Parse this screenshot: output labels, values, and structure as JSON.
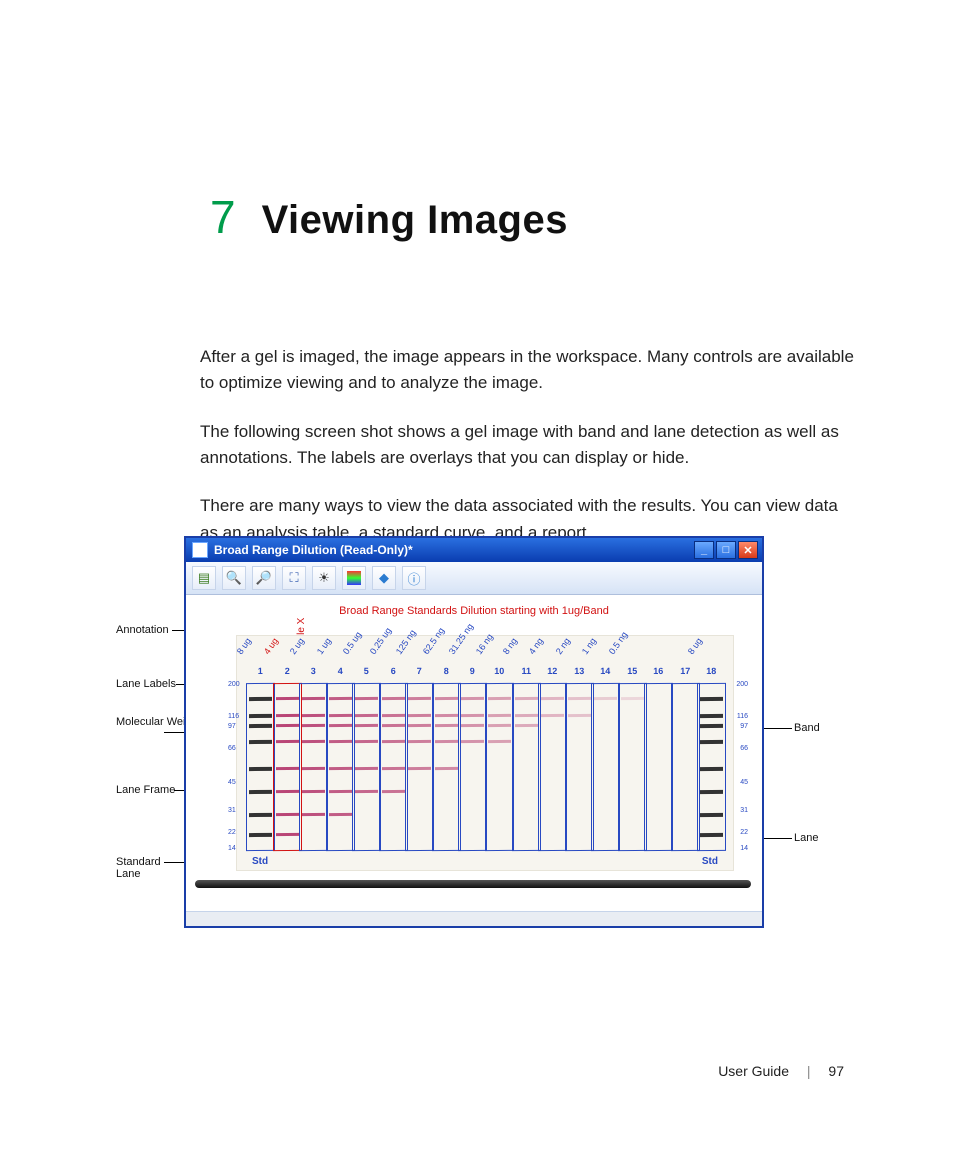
{
  "chapter": {
    "number": "7",
    "title": "Viewing Images"
  },
  "paragraphs": {
    "p1": "After a gel is imaged, the image appears in the workspace. Many controls are available to optimize viewing and to analyze the image.",
    "p2": "The following screen shot shows a gel image with band and lane detection as well as annotations. The labels are overlays that you can display or hide.",
    "p3": "There are many ways to view the data associated with the results. You can view data as an analysis table, a standard curve, and a report."
  },
  "window": {
    "title": "Broad Range Dilution (Read-Only)*",
    "heading": "Broad Range Standards Dilution starting with 1ug/Band",
    "sample_annotation": "Sample X",
    "std_label": "Std",
    "lane_top_labels": [
      "8 ug",
      "4 ug",
      "2 ug",
      "1 ug",
      "0.5 ug",
      "0.25 ug",
      "125 ng",
      "62.5 ng",
      "31.25 ng",
      "16 ng",
      "8 ng",
      "4 ng",
      "2 ng",
      "1 ng",
      "0.5 ng",
      "",
      "",
      "8 ug"
    ],
    "lane_numbers": [
      "1",
      "2",
      "3",
      "4",
      "5",
      "6",
      "7",
      "8",
      "9",
      "10",
      "11",
      "12",
      "13",
      "14",
      "15",
      "16",
      "17",
      "18"
    ],
    "mw_left": [
      "200",
      "116",
      "97",
      "66",
      "45",
      "31",
      "22",
      "14"
    ],
    "mw_right": [
      "200",
      "116",
      "97",
      "66",
      "45",
      "31",
      "22",
      "14"
    ]
  },
  "toolbar": {
    "tree": "Tree view",
    "zoom_in": "Zoom in",
    "zoom_out": "Zoom out",
    "fit": "Fit to window",
    "brightness": "Brightness",
    "color": "Color map",
    "tag": "Tag",
    "info": "Info"
  },
  "callouts": {
    "annotation": "Annotation",
    "lane_labels": "Lane Labels",
    "mw_labels": "Molecular Weight Labels",
    "lane_frame": "Lane Frame",
    "standard_lane": "Standard Lane",
    "band": "Band",
    "lane": "Lane"
  },
  "footer": {
    "doc": "User Guide",
    "page": "97"
  }
}
